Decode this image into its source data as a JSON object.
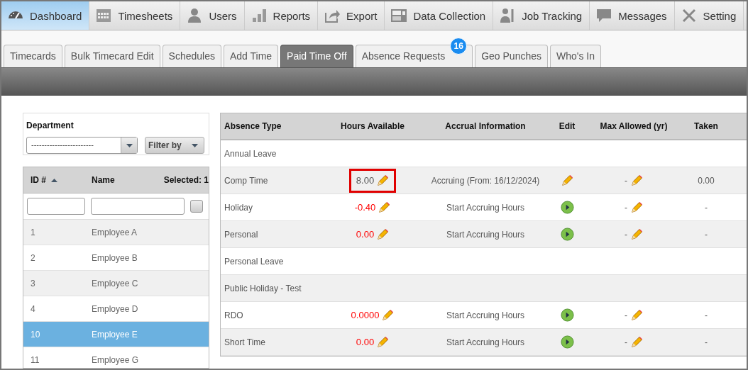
{
  "nav": [
    {
      "label": "Dashboard",
      "kind": "gauge",
      "selected": true
    },
    {
      "label": "Timesheets",
      "kind": "calendar",
      "selected": false
    },
    {
      "label": "Users",
      "kind": "person",
      "selected": false
    },
    {
      "label": "Reports",
      "kind": "bars",
      "selected": false
    },
    {
      "label": "Export",
      "kind": "share",
      "selected": false
    },
    {
      "label": "Data Collection",
      "kind": "terminal",
      "selected": false
    },
    {
      "label": "Job Tracking",
      "kind": "worker",
      "selected": false
    },
    {
      "label": "Messages",
      "kind": "bubble",
      "selected": false
    },
    {
      "label": "Setting",
      "kind": "tools",
      "selected": false
    }
  ],
  "tabs": [
    {
      "label": "Timecards",
      "selected": false
    },
    {
      "label": "Bulk Timecard Edit",
      "selected": false
    },
    {
      "label": "Schedules",
      "selected": false
    },
    {
      "label": "Add Time",
      "selected": false
    },
    {
      "label": "Paid Time Off",
      "selected": true
    },
    {
      "label": "Absence Requests",
      "selected": false,
      "badge": "16"
    },
    {
      "label": "Geo Punches",
      "selected": false
    },
    {
      "label": "Who's In",
      "selected": false
    }
  ],
  "filter": {
    "label": "Department",
    "department": "------------------------",
    "filter_button": "Filter by"
  },
  "employees": {
    "columns": [
      "ID #",
      "Name",
      "Selected: 1"
    ],
    "select_all": {
      "checked": false
    },
    "rows": [
      {
        "id": "1",
        "name": "Employee A",
        "selected": false
      },
      {
        "id": "2",
        "name": "Employee B",
        "selected": false
      },
      {
        "id": "3",
        "name": "Employee C",
        "selected": false
      },
      {
        "id": "4",
        "name": "Employee D",
        "selected": false
      },
      {
        "id": "10",
        "name": "Employee E",
        "selected": true
      },
      {
        "id": "11",
        "name": "Employee G",
        "selected": false
      }
    ]
  },
  "absences": {
    "columns": [
      "Absence Type",
      "Hours Available",
      "Accrual Information",
      "Edit",
      "Max Allowed (yr)",
      "Taken"
    ],
    "rows": [
      {
        "type": "Annual Leave"
      },
      {
        "type": "Comp Time",
        "hours": "8.00",
        "color": "#555555",
        "highlighted": true,
        "accrual": "Accruing (From: 16/12/2024)",
        "edit": {
          "kind": "pencil"
        },
        "max": "-",
        "taken": "0.00"
      },
      {
        "type": "Holiday",
        "hours": "-0.40",
        "color": "#ff0000",
        "highlighted": false,
        "accrual": "Start Accruing Hours",
        "edit": {
          "kind": "play"
        },
        "max": "-",
        "taken": "-"
      },
      {
        "type": "Personal",
        "hours": "0.00",
        "color": "#ff0000",
        "highlighted": false,
        "accrual": "Start Accruing Hours",
        "edit": {
          "kind": "play"
        },
        "max": "-",
        "taken": "-"
      },
      {
        "type": "Personal Leave"
      },
      {
        "type": "Public Holiday - Test"
      },
      {
        "type": "RDO",
        "hours": "0.0000",
        "color": "#ff0000",
        "highlighted": false,
        "accrual": "Start Accruing Hours",
        "edit": {
          "kind": "play"
        },
        "max": "-",
        "taken": "-"
      },
      {
        "type": "Short Time",
        "hours": "0.00",
        "color": "#ff0000",
        "highlighted": false,
        "accrual": "Start Accruing Hours",
        "edit": {
          "kind": "play"
        },
        "max": "-",
        "taken": "-"
      }
    ]
  }
}
